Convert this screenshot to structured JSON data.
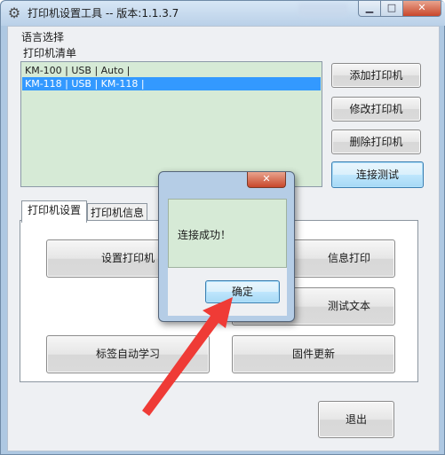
{
  "window": {
    "title": "打印机设置工具 -- 版本:1.1.3.7",
    "close_glyph": "✕",
    "min_glyph": "",
    "max_glyph": ""
  },
  "language_label": "语言选择",
  "printer_list": {
    "label": "打印机清单",
    "items": [
      {
        "text": "KM-100 | USB | Auto |",
        "selected": false
      },
      {
        "text": "KM-118 | USB | KM-118 |",
        "selected": true
      }
    ]
  },
  "side_buttons": {
    "add": "添加打印机",
    "modify": "修改打印机",
    "delete": "删除打印机",
    "test": "连接测试"
  },
  "tabs": {
    "settings": "打印机设置",
    "info": "打印机信息"
  },
  "panel_buttons": {
    "setup": "设置打印机",
    "info_print": "信息打印",
    "test_text": "测试文本",
    "label_learn": "标签自动学习",
    "firmware": "固件更新"
  },
  "exit_button": "退出",
  "dialog": {
    "message": "连接成功！",
    "ok": "确定",
    "close_glyph": "✕"
  },
  "colors": {
    "list_bg": "#d6ead6",
    "selection": "#3399ff",
    "arrow": "#ef3b36"
  }
}
